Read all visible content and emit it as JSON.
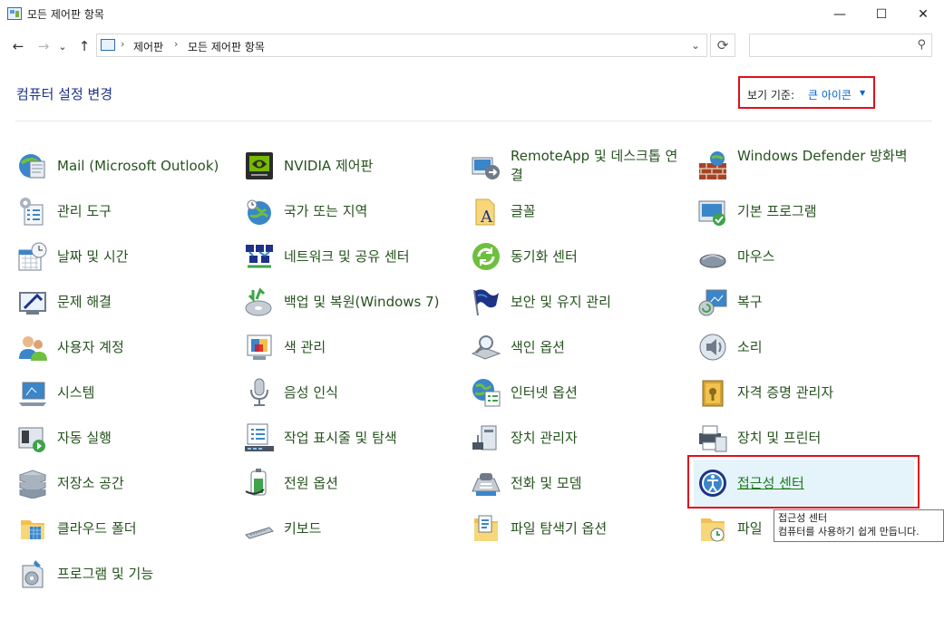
{
  "window": {
    "title": "모든 제어판 항목",
    "min": "—",
    "max": "☐",
    "close": "✕"
  },
  "nav": {
    "back": "←",
    "forward": "→",
    "recent": "⌄",
    "up": "↑",
    "crumbs": [
      "제어판",
      "모든 제어판 항목"
    ],
    "sep": "›",
    "dropdown": "⌄",
    "refresh": "⟳",
    "search_placeholder": "",
    "search_icon": "⚲"
  },
  "heading": "컴퓨터 설정 변경",
  "view_by": {
    "label": "보기 기준:",
    "value": "큰 아이콘",
    "caret": "▼"
  },
  "items": [
    {
      "label": "Mail (Microsoft Outlook)",
      "icon": "mail-icon"
    },
    {
      "label": "NVIDIA 제어판",
      "icon": "nvidia-icon"
    },
    {
      "label": "RemoteApp 및 데스크톱 연결",
      "icon": "remoteapp-icon"
    },
    {
      "label": "Windows Defender 방화벽",
      "icon": "firewall-icon"
    },
    {
      "label": "관리 도구",
      "icon": "admin-tools-icon"
    },
    {
      "label": "국가 또는 지역",
      "icon": "region-icon"
    },
    {
      "label": "글꼴",
      "icon": "fonts-icon"
    },
    {
      "label": "기본 프로그램",
      "icon": "default-programs-icon"
    },
    {
      "label": "날짜 및 시간",
      "icon": "date-time-icon"
    },
    {
      "label": "네트워크 및 공유 센터",
      "icon": "network-icon"
    },
    {
      "label": "동기화 센터",
      "icon": "sync-icon"
    },
    {
      "label": "마우스",
      "icon": "mouse-icon"
    },
    {
      "label": "문제 해결",
      "icon": "troubleshoot-icon"
    },
    {
      "label": "백업 및 복원(Windows 7)",
      "icon": "backup-icon"
    },
    {
      "label": "보안 및 유지 관리",
      "icon": "security-flag-icon"
    },
    {
      "label": "복구",
      "icon": "recovery-icon"
    },
    {
      "label": "사용자 계정",
      "icon": "user-accounts-icon"
    },
    {
      "label": "색 관리",
      "icon": "color-management-icon"
    },
    {
      "label": "색인 옵션",
      "icon": "indexing-icon"
    },
    {
      "label": "소리",
      "icon": "sound-icon"
    },
    {
      "label": "시스템",
      "icon": "system-icon"
    },
    {
      "label": "음성 인식",
      "icon": "speech-icon"
    },
    {
      "label": "인터넷 옵션",
      "icon": "internet-options-icon"
    },
    {
      "label": "자격 증명 관리자",
      "icon": "credential-icon"
    },
    {
      "label": "자동 실행",
      "icon": "autoplay-icon"
    },
    {
      "label": "작업 표시줄 및 탐색",
      "icon": "taskbar-icon"
    },
    {
      "label": "장치 관리자",
      "icon": "device-manager-icon"
    },
    {
      "label": "장치 및 프린터",
      "icon": "printer-icon"
    },
    {
      "label": "저장소 공간",
      "icon": "storage-icon"
    },
    {
      "label": "전원 옵션",
      "icon": "power-icon"
    },
    {
      "label": "전화 및 모뎀",
      "icon": "phone-modem-icon"
    },
    {
      "label": "접근성 센터",
      "icon": "ease-of-access-icon"
    },
    {
      "label": "클라우드 폴더",
      "icon": "cloud-folder-icon"
    },
    {
      "label": "키보드",
      "icon": "keyboard-icon"
    },
    {
      "label": "파일 탐색기 옵션",
      "icon": "explorer-options-icon"
    },
    {
      "label": "파일",
      "icon": "file-history-icon"
    },
    {
      "label": "프로그램 및 기능",
      "icon": "programs-features-icon"
    }
  ],
  "tooltip": {
    "title": "접근성 센터",
    "desc": "컴퓨터를 사용하기 쉽게 만듭니다."
  }
}
